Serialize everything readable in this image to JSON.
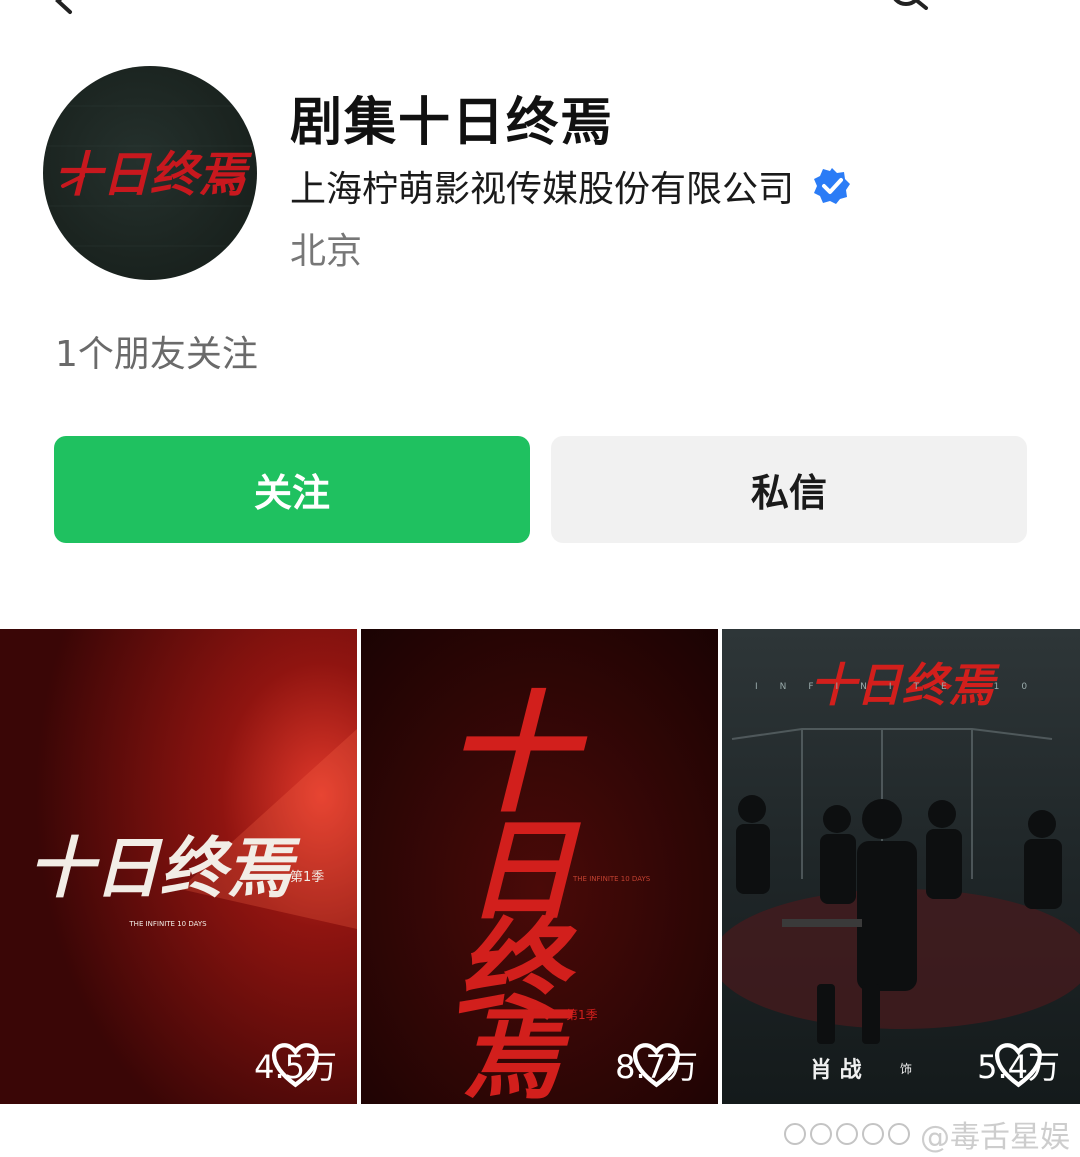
{
  "header": {
    "back_icon": "chevron-left-icon",
    "search_icon": "search-icon"
  },
  "profile": {
    "avatar_text": "十日终焉",
    "name": "剧集十日终焉",
    "organization": "上海柠萌影视传媒股份有限公司",
    "verified_color": "#2b7cf6",
    "location": "北京",
    "friends_following": "1个朋友关注"
  },
  "actions": {
    "follow_label": "关注",
    "follow_color": "#1fc160",
    "message_label": "私信"
  },
  "posts": [
    {
      "likes": "4.5万",
      "poster_title": "十日终焉",
      "poster_subtitle": "THE INFINITE 10 DAYS",
      "season": "第1季"
    },
    {
      "likes": "8.7万",
      "poster_title": "十日终焉",
      "poster_subtitle": "THE INFINITE 10 DAYS",
      "season": "第1季"
    },
    {
      "likes": "5.4万",
      "poster_title": "十日终焉",
      "poster_banner": "INFINITE 10",
      "actor_name": "肖 战",
      "actor_role": "饰"
    }
  ],
  "watermark": "@毒舌星娱"
}
